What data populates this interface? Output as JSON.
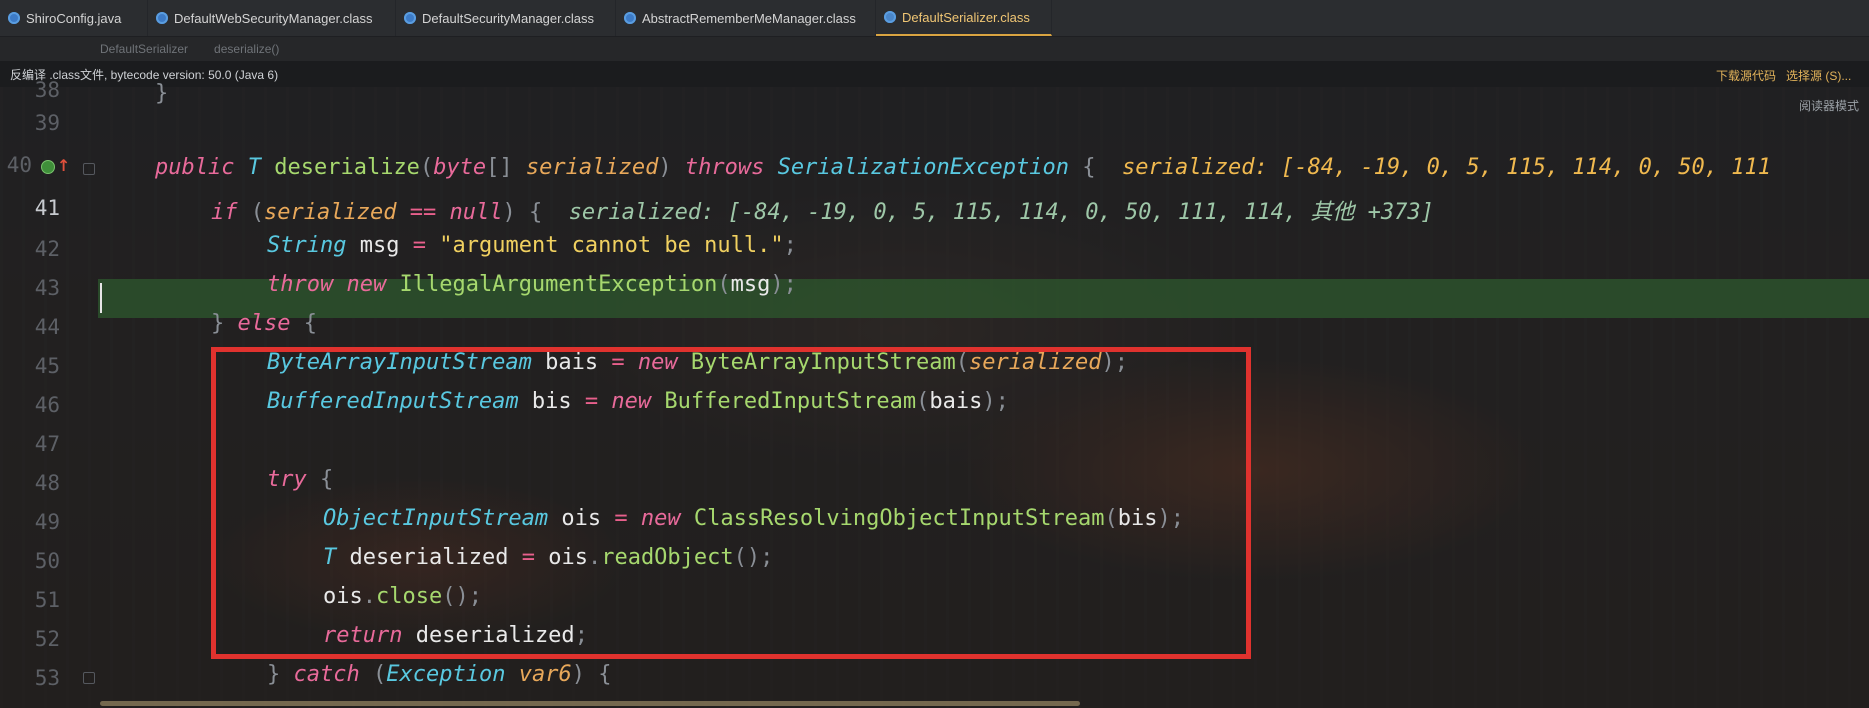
{
  "tabs": [
    {
      "label": "ShiroConfig.java",
      "icon": "class-icon",
      "active": false
    },
    {
      "label": "DefaultWebSecurityManager.class",
      "icon": "class-icon",
      "active": false
    },
    {
      "label": "DefaultSecurityManager.class",
      "icon": "class-icon",
      "active": false
    },
    {
      "label": "AbstractRememberMeManager.class",
      "icon": "class-icon",
      "active": false
    },
    {
      "label": "DefaultSerializer.class",
      "icon": "class-icon",
      "active": true
    }
  ],
  "breadcrumb": {
    "class": "DefaultSerializer",
    "method": "deserialize()"
  },
  "banner": {
    "text": "反编译 .class文件, bytecode version: 50.0 (Java 6)",
    "download_label": "下载源代码",
    "choose_source_label": "选择源 (S)..."
  },
  "reader_mode_label": "阅读器模式",
  "line_numbers": [
    "38",
    "39",
    "40",
    "41",
    "42",
    "43",
    "44",
    "45",
    "46",
    "47",
    "48",
    "49",
    "50",
    "51",
    "52",
    "53"
  ],
  "current_line": "41",
  "code": {
    "l38": "}",
    "l40": {
      "kw_public": "public",
      "type_T": "T",
      "method": "deserialize",
      "kw_byte": "byte",
      "brackets": "[]",
      "param": "serialized",
      "kw_throws": "throws",
      "exception": "SerializationException",
      "brace": "{",
      "hint": "serialized: [-84, -19, 0, 5, 115, 114, 0, 50, 111"
    },
    "l41": {
      "kw_if": "if",
      "param": "serialized",
      "op": "==",
      "kw_null": "null",
      "brace": "{",
      "hint": "serialized: [-84, -19, 0, 5, 115, 114, 0, 50, 111, 114, 其他 +373]"
    },
    "l42": {
      "type": "String",
      "var": "msg",
      "op": "=",
      "str": "\"argument cannot be null.\"",
      "end": ";"
    },
    "l43": {
      "kw_throw": "throw",
      "kw_new": "new",
      "cls": "IllegalArgumentException",
      "arg": "msg",
      "end": ");"
    },
    "l44": {
      "brace": "}",
      "kw_else": "else",
      "brace2": "{"
    },
    "l45": {
      "type": "ByteArrayInputStream",
      "var": "bais",
      "op": "=",
      "kw_new": "new",
      "cls": "ByteArrayInputStream",
      "arg": "serialized",
      "end": ");"
    },
    "l46": {
      "type": "BufferedInputStream",
      "var": "bis",
      "op": "=",
      "kw_new": "new",
      "cls": "BufferedInputStream",
      "arg": "bais",
      "end": ");"
    },
    "l48": {
      "kw_try": "try",
      "brace": "{"
    },
    "l49": {
      "type": "ObjectInputStream",
      "var": "ois",
      "op": "=",
      "kw_new": "new",
      "cls": "ClassResolvingObjectInputStream",
      "arg": "bis",
      "end": ");"
    },
    "l50": {
      "type": "T",
      "var": "deserialized",
      "op": "=",
      "obj": "ois",
      "call": "readObject",
      "end": "();"
    },
    "l51": {
      "obj": "ois",
      "call": "close",
      "end": "();"
    },
    "l52": {
      "kw_return": "return",
      "var": "deserialized",
      "end": ";"
    },
    "l53": {
      "brace": "}",
      "kw_catch": "catch",
      "type": "Exception",
      "param": "var6",
      "brace2": "{"
    }
  },
  "colors": {
    "keyword": "#e86a9a",
    "type": "#59c8e0",
    "method": "#a6d86e",
    "param": "#e8a85a",
    "string": "#f0d060",
    "highlight_box": "#e0322e",
    "current_line_bg": "#2e582e"
  }
}
